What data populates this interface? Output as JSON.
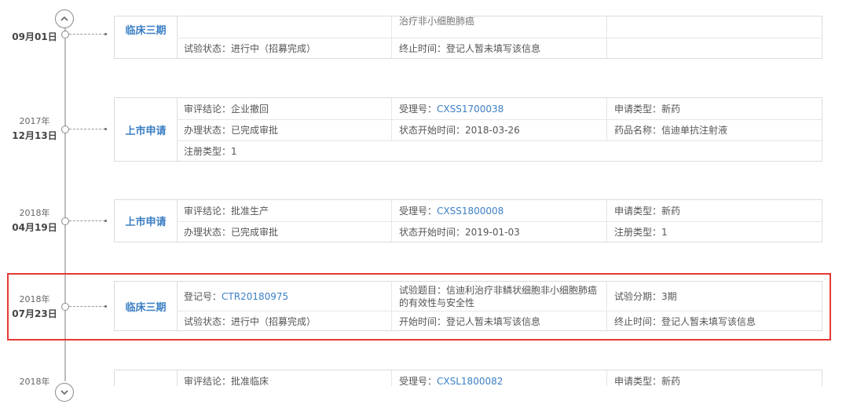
{
  "nav": {
    "up_icon": "chevron-up-icon",
    "down_icon": "chevron-down-icon"
  },
  "entries": [
    {
      "year": "",
      "date": "09月01日",
      "type": "临床三期",
      "rows": [
        {
          "cells": [
            {
              "label": "",
              "value": ""
            },
            {
              "label": "",
              "value": "治疗非小细胞肺癌"
            },
            {
              "label": "",
              "value": ""
            }
          ]
        },
        {
          "cells": [
            {
              "label": "试验状态：",
              "value": "进行中（招募完成）"
            },
            {
              "label": "终止时间：",
              "value": "登记人暂未填写该信息"
            },
            {
              "label": "",
              "value": ""
            }
          ]
        }
      ]
    },
    {
      "year": "2017年",
      "date": "12月13日",
      "type": "上市申请",
      "rows": [
        {
          "cells": [
            {
              "label": "审评结论：",
              "value": "企业撤回"
            },
            {
              "label": "受理号：",
              "value": "CXSS1700038"
            },
            {
              "label": "申请类型：",
              "value": "新药"
            }
          ]
        },
        {
          "cells": [
            {
              "label": "办理状态：",
              "value": "已完成审批"
            },
            {
              "label": "状态开始时间：",
              "value": "2018-03-26"
            },
            {
              "label": "药品名称：",
              "value": "信迪单抗注射液"
            }
          ]
        },
        {
          "cells": [
            {
              "label": "注册类型：",
              "value": "1"
            }
          ]
        }
      ]
    },
    {
      "year": "2018年",
      "date": "04月19日",
      "type": "上市申请",
      "rows": [
        {
          "cells": [
            {
              "label": "审评结论：",
              "value": "批准生产"
            },
            {
              "label": "受理号：",
              "value": "CXSS1800008"
            },
            {
              "label": "申请类型：",
              "value": "新药"
            }
          ]
        },
        {
          "cells": [
            {
              "label": "办理状态：",
              "value": "已完成审批"
            },
            {
              "label": "状态开始时间：",
              "value": "2019-01-03"
            },
            {
              "label": "注册类型：",
              "value": "1"
            }
          ]
        }
      ]
    },
    {
      "year": "2018年",
      "date": "07月23日",
      "type": "临床三期",
      "rows": [
        {
          "cells": [
            {
              "label": "登记号：",
              "value": "CTR20180975"
            },
            {
              "label": "试验题目：",
              "value": "信迪利治疗非鳞状细胞非小细胞肺癌的有效性与安全性"
            },
            {
              "label": "试验分期：",
              "value": "3期"
            }
          ]
        },
        {
          "cells": [
            {
              "label": "试验状态：",
              "value": "进行中（招募完成）"
            },
            {
              "label": "开始时间：",
              "value": "登记人暂未填写该信息"
            },
            {
              "label": "终止时间：",
              "value": "登记人暂未填写该信息"
            }
          ]
        }
      ]
    },
    {
      "year": "2018年",
      "date": "",
      "type": "",
      "rows": [
        {
          "cells": [
            {
              "label": "审评结论：",
              "value": "批准临床"
            },
            {
              "label": "受理号：",
              "value": "CXSL1800082"
            },
            {
              "label": "申请类型：",
              "value": "新药"
            }
          ]
        }
      ]
    }
  ]
}
